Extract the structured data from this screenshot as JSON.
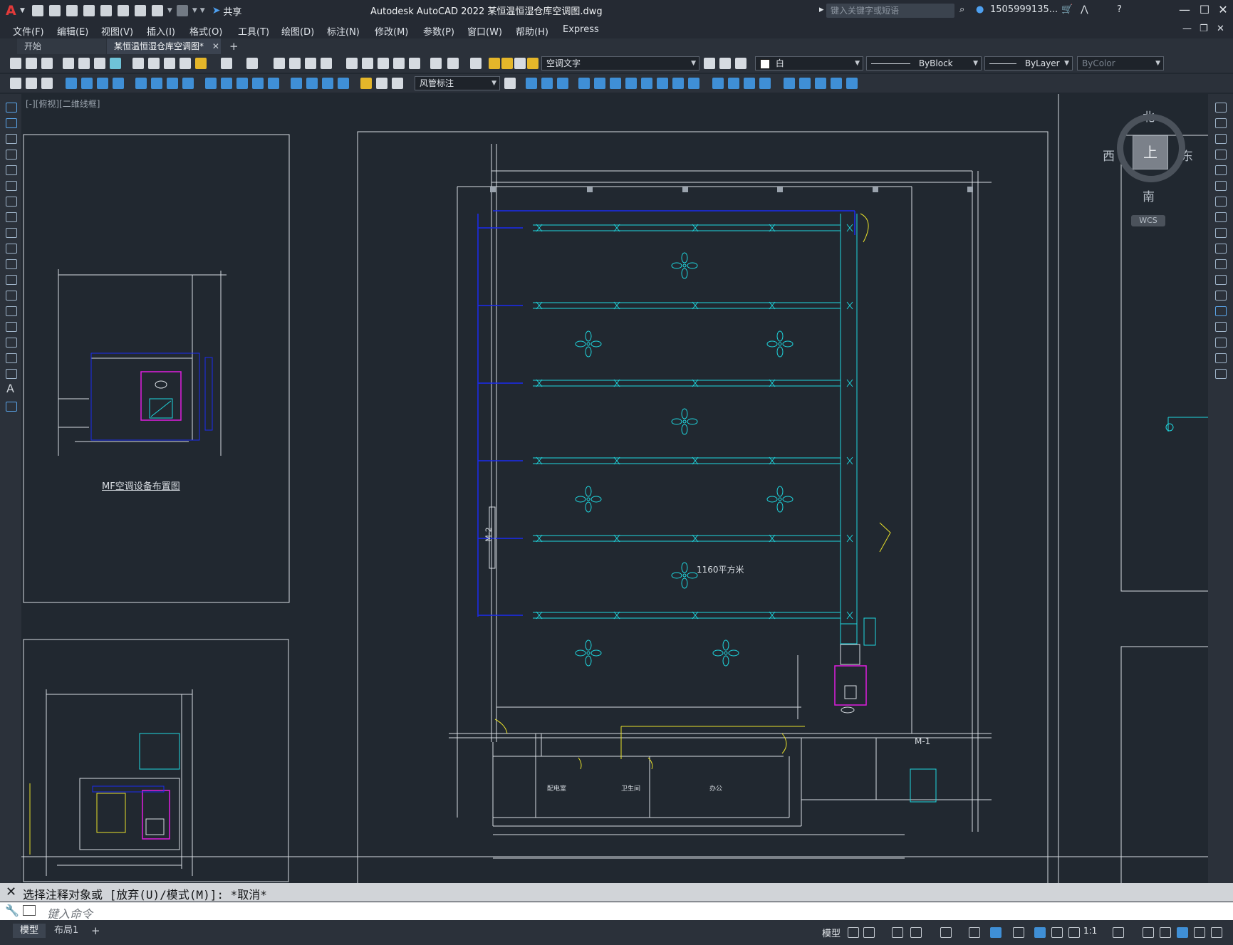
{
  "app": {
    "title": "Autodesk AutoCAD 2022    某恒温恒湿仓库空调图.dwg",
    "share_label": "共享",
    "search_placeholder": "键入关键字或短语",
    "user_id": "1505999135...",
    "logo_letter": "A"
  },
  "menu": [
    "文件(F)",
    "编辑(E)",
    "视图(V)",
    "插入(I)",
    "格式(O)",
    "工具(T)",
    "绘图(D)",
    "标注(N)",
    "修改(M)",
    "参数(P)",
    "窗口(W)",
    "帮助(H)",
    "Express"
  ],
  "tabs": {
    "start": "开始",
    "active": "某恒温恒湿仓库空调图*",
    "close": "✕",
    "add": "+"
  },
  "toolbar": {
    "layer_name": "空调文字",
    "color_value": "白",
    "linetype_value": "ByBlock",
    "lineweight_value": "ByLayer",
    "plotstyle_value": "ByColor",
    "dimstyle_value": "风管标注"
  },
  "viewport": {
    "label": "[-][俯视][二维线框]"
  },
  "viewcube": {
    "north": "北",
    "south": "南",
    "east": "东",
    "west": "西",
    "top": "上",
    "wcs": "WCS"
  },
  "drawing_text": {
    "equipment_plan_title": "MF空调设备布置图",
    "area_label": "1160平方米",
    "door_label_m1": "M-1",
    "door_label_m2": "M-2",
    "room_office": "办公",
    "room_toilet": "卫生间",
    "room_prep": "配电室"
  },
  "command": {
    "history": "选择注释对象或 [放弃(U)/模式(M)]: *取消*",
    "input_placeholder": "键入命令"
  },
  "status": {
    "model_tab": "模型",
    "layout_tab": "布局1",
    "add": "+",
    "space_label": "模型",
    "scale": "1:1"
  },
  "colors": {
    "background": "#212830",
    "duct_cyan": "#1fd7df",
    "pipe_blue": "#1a2bf2",
    "equipment_magenta": "#e01ee0",
    "highlight_yellow": "#e8e02a",
    "wall_white": "#d8dde2"
  }
}
